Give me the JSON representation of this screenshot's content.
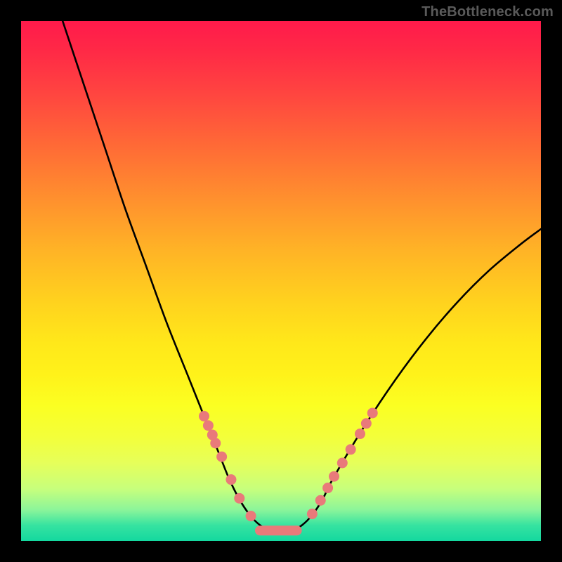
{
  "watermark": "TheBottleneck.com",
  "colors": {
    "background": "#000000",
    "curve_stroke": "#000000",
    "marker_fill": "#e97a7a",
    "marker_stroke": "#ad4b4b"
  },
  "chart_data": {
    "type": "line",
    "title": "",
    "xlabel": "",
    "ylabel": "",
    "xlim": [
      0,
      100
    ],
    "ylim": [
      0,
      100
    ],
    "grid": false,
    "legend": false,
    "series": [
      {
        "name": "curve",
        "x": [
          8,
          12,
          16,
          20,
          24,
          28,
          32,
          36,
          38,
          40,
          42,
          44,
          46,
          48,
          50,
          52,
          54,
          56,
          58,
          60,
          66,
          72,
          78,
          84,
          90,
          96,
          100
        ],
        "y": [
          100,
          88,
          76,
          64,
          53,
          42,
          32,
          22,
          17,
          12,
          8,
          5,
          3,
          2,
          2,
          2,
          3,
          5,
          8,
          12,
          22,
          31,
          39,
          46,
          52,
          57,
          60
        ]
      }
    ],
    "markers_left": {
      "note": "markers overlaid on the descending arm of the curve",
      "x": [
        35.2,
        36.0,
        36.8,
        37.4,
        38.6,
        40.4,
        42.0,
        44.2
      ],
      "y": [
        24.0,
        22.2,
        20.4,
        18.8,
        16.2,
        11.8,
        8.2,
        4.8
      ]
    },
    "markers_right": {
      "note": "markers overlaid on the ascending arm of the curve",
      "x": [
        56.0,
        57.6,
        59.0,
        60.2,
        61.8,
        63.4,
        65.2,
        66.4,
        67.6
      ],
      "y": [
        5.2,
        7.8,
        10.2,
        12.4,
        15.0,
        17.6,
        20.6,
        22.6,
        24.6
      ]
    },
    "plateau_bar": {
      "note": "short flat salmon segment at the valley floor",
      "x0": 45.0,
      "x1": 54.0,
      "y": 2.0
    }
  }
}
